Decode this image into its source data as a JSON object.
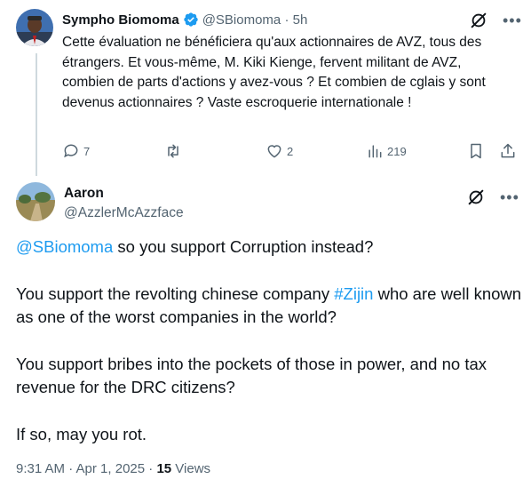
{
  "parent_tweet": {
    "author_name": "Sympho Biomoma",
    "handle_time": "@SBiomoma · 5h",
    "text": "Cette évaluation ne bénéficiera qu'aux actionnaires de AVZ, tous des étrangers. Et vous-même, M. Kiki Kienge, fervent militant de AVZ, combien de parts d'actions y avez-vous ? Et combien de cglais y sont devenus actionnaires ? Vaste escroquerie internationale !",
    "replies": "7",
    "retweets": "",
    "likes": "2",
    "views": "219"
  },
  "main_tweet": {
    "author_name": "Aaron",
    "handle": "@AzzlerMcAzzface",
    "mention": "@SBiomoma",
    "line1_rest": " so you support Corruption instead?",
    "para2_before": "You support the revolting chinese company ",
    "hashtag": "#Zijin",
    "para2_after": " who are well known as one of the worst companies in the world?",
    "para3": "You support bribes into the pockets of those in power, and no tax revenue for the DRC citizens?",
    "para4": "If so, may you rot.",
    "timestamp": "9:31 AM · Apr 1, 2025 · ",
    "view_count": "15",
    "views_label": " Views"
  },
  "colors": {
    "accent": "#1d9bf0",
    "muted": "#536471",
    "text": "#0f1419"
  },
  "icons": [
    "verified-badge-icon",
    "grok-icon",
    "more-icon",
    "reply-icon",
    "retweet-icon",
    "like-icon",
    "views-icon",
    "bookmark-icon",
    "share-icon"
  ]
}
